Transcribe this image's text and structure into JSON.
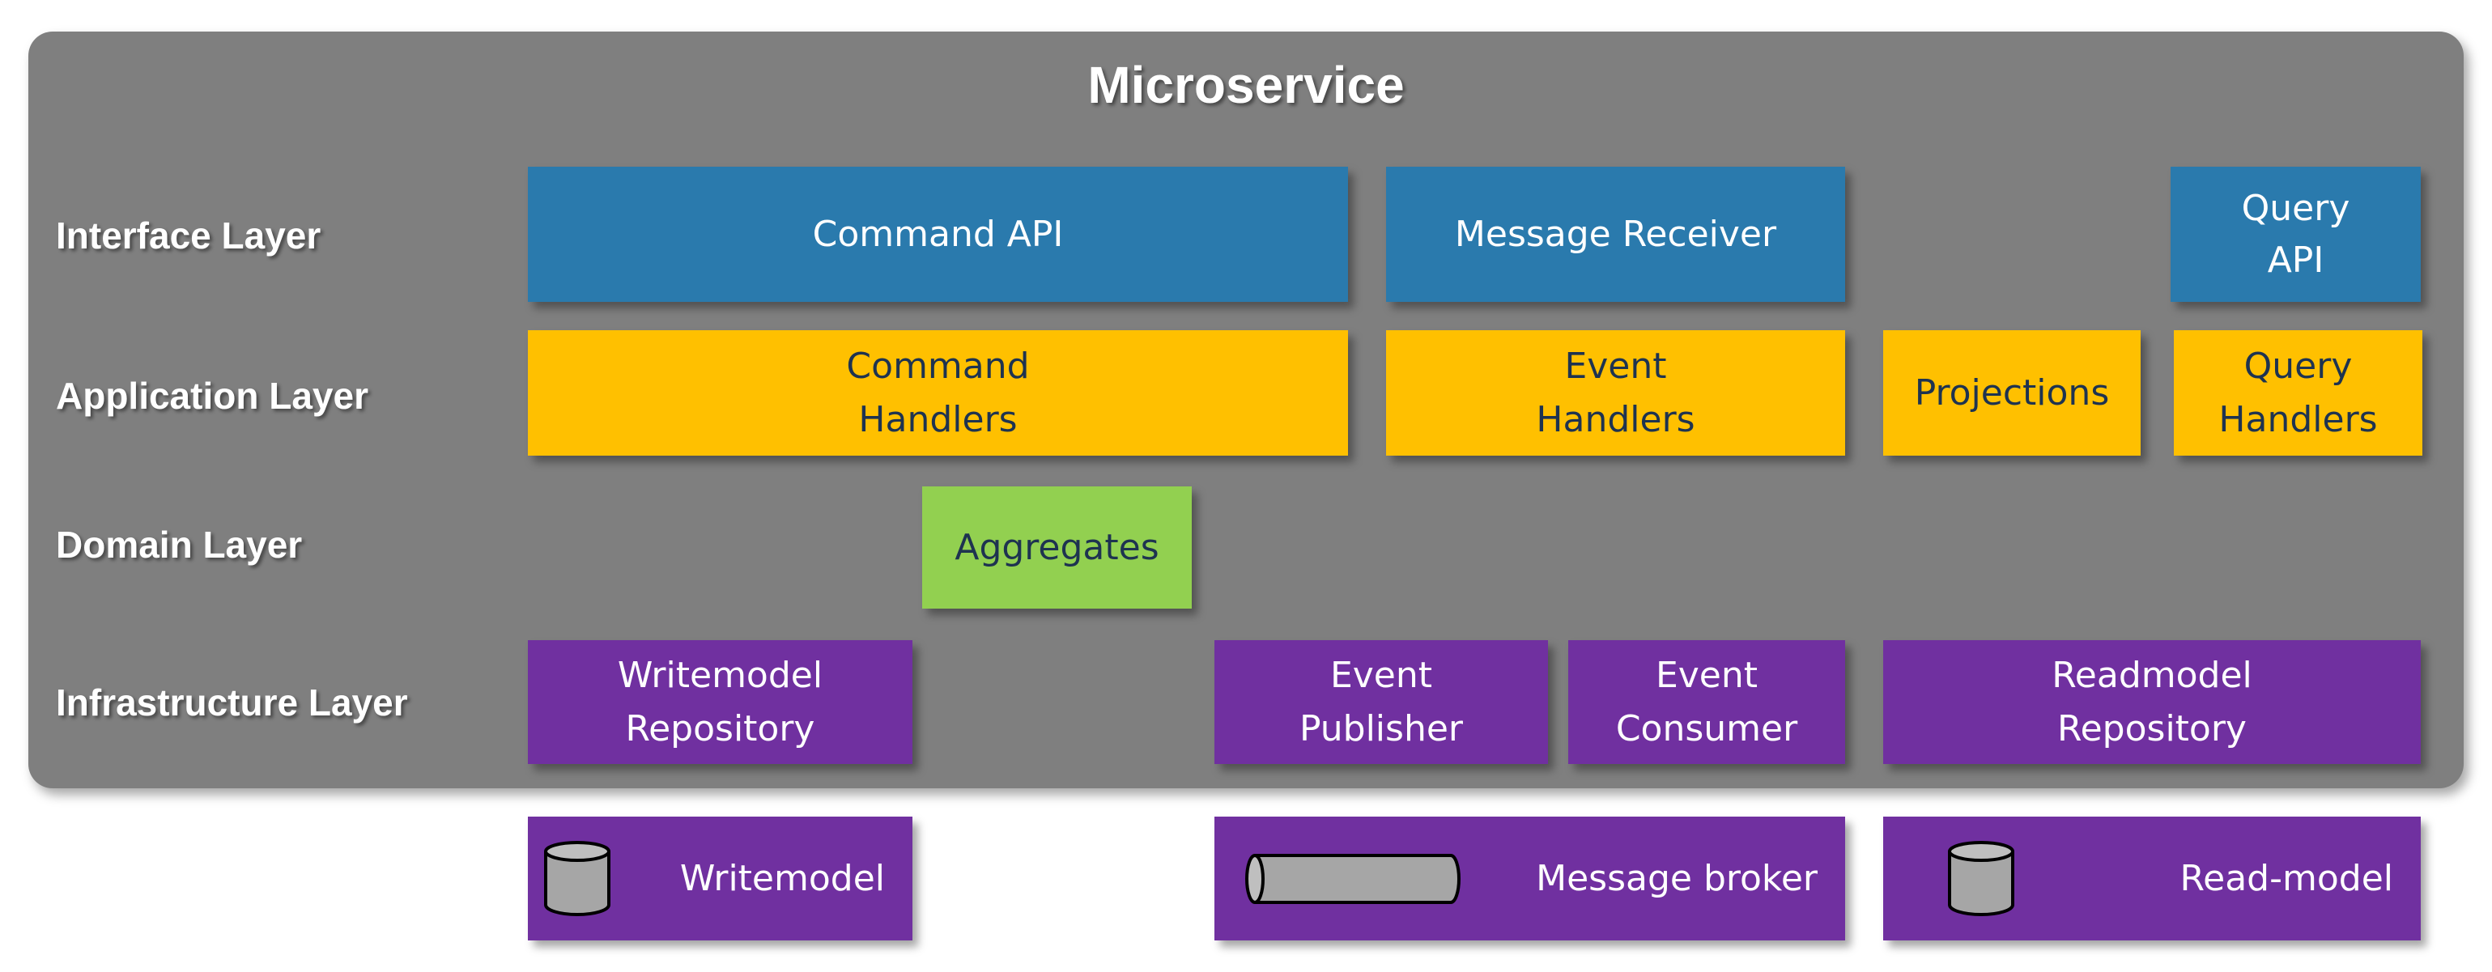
{
  "diagram": {
    "title": "Microservice",
    "layers": [
      {
        "id": "interface",
        "label": "Interface Layer"
      },
      {
        "id": "application",
        "label": "Application Layer"
      },
      {
        "id": "domain",
        "label": "Domain Layer"
      },
      {
        "id": "infrastructure",
        "label": "Infrastructure Layer"
      }
    ],
    "interface": {
      "command_api": "Command API",
      "message_receiver": "Message Receiver",
      "query_api": "Query\nAPI"
    },
    "application": {
      "command_handlers": "Command\nHandlers",
      "event_handlers": "Event\nHandlers",
      "projections": "Projections",
      "query_handlers": "Query\nHandlers"
    },
    "domain": {
      "aggregates": "Aggregates"
    },
    "infrastructure": {
      "writemodel_repository": "Writemodel\nRepository",
      "event_publisher": "Event\nPublisher",
      "event_consumer": "Event\nConsumer",
      "readmodel_repository": "Readmodel\nRepository"
    },
    "external": {
      "writemodel": {
        "label": "Writemodel",
        "icon": "database-cylinder-icon"
      },
      "message_broker": {
        "label": "Message broker",
        "icon": "pipe-queue-icon"
      },
      "readmodel": {
        "label": "Read-model",
        "icon": "database-cylinder-icon"
      }
    },
    "colors": {
      "panel": "#7f7f7f",
      "interface": "#2a7aad",
      "application": "#ffc000",
      "domain": "#92d050",
      "infrastructure": "#7030a0",
      "dark_text": "#1e3350"
    }
  }
}
